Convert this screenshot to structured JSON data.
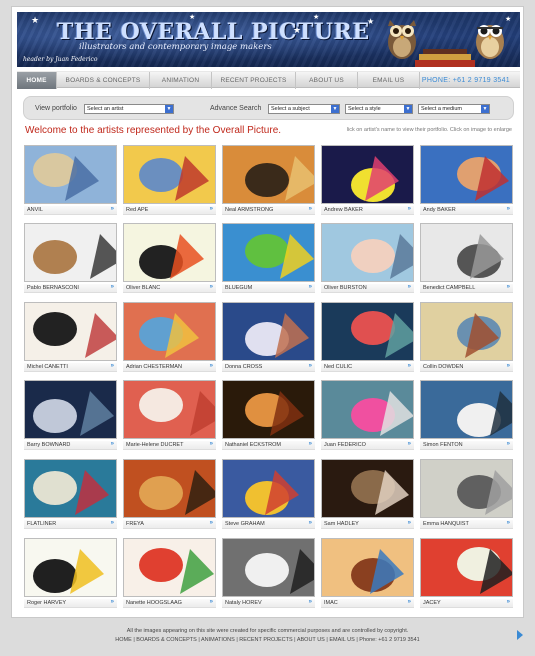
{
  "header": {
    "title": "THE OVERALL PICTURE",
    "subtitle": "illustrators and contemporary image makers",
    "credit": "header by Juan Federico"
  },
  "nav": {
    "items": [
      {
        "label": "HOME",
        "active": true
      },
      {
        "label": "BOARDS & CONCEPTS",
        "active": false
      },
      {
        "label": "ANIMATION",
        "active": false
      },
      {
        "label": "RECENT PROJECTS",
        "active": false
      },
      {
        "label": "ABOUT US",
        "active": false
      },
      {
        "label": "EMAIL US",
        "active": false
      }
    ],
    "phone": "PHONE: +61 2 9719 3541"
  },
  "search": {
    "view_label": "View portfolio",
    "artist_select": "Select an artist",
    "advance_label": "Advance Search",
    "subject_select": "Select a subject",
    "style_select": "Select a style",
    "medium_select": "Select a medium"
  },
  "welcome": "Welcome to the artists represented by the Overall Picture.",
  "hint": "lick on artist's name to view their portfolio. Click on image to enlarge",
  "artists": [
    {
      "name": "ANVIL"
    },
    {
      "name": "Red APE"
    },
    {
      "name": "Neal ARMSTRONG"
    },
    {
      "name": "Andrew BAKER"
    },
    {
      "name": "Andy BAKER"
    },
    {
      "name": "Pablo BERNASCONI"
    },
    {
      "name": "Oliver BLANC"
    },
    {
      "name": "BLUEGUM"
    },
    {
      "name": "Oliver BURSTON"
    },
    {
      "name": "Benedict CAMPBELL"
    },
    {
      "name": "Michel CANETTI"
    },
    {
      "name": "Adrian CHESTERMAN"
    },
    {
      "name": "Donna CROSS"
    },
    {
      "name": "Ned CULIC"
    },
    {
      "name": "Collin DOWDEN"
    },
    {
      "name": "Barry BOWNARD"
    },
    {
      "name": "Marie-Helene DUCRET"
    },
    {
      "name": "Nathaniel ECKSTROM"
    },
    {
      "name": "Juan FEDERICO"
    },
    {
      "name": "Simon FENTON"
    },
    {
      "name": "FLATLINER"
    },
    {
      "name": "FREYA"
    },
    {
      "name": "Steve GRAHAM"
    },
    {
      "name": "Sam HADLEY"
    },
    {
      "name": "Emma HANQUIST"
    },
    {
      "name": "Roger HARVEY"
    },
    {
      "name": "Nanette HOOGSLAAG"
    },
    {
      "name": "Nataly HOREV"
    },
    {
      "name": "IMAC"
    },
    {
      "name": "JACEY"
    }
  ],
  "thumb_palettes": [
    [
      "#8fb3d9",
      "#d9c8a0",
      "#4a6fa5"
    ],
    [
      "#f2c94c",
      "#6b8fbf",
      "#c0392b"
    ],
    [
      "#d98c3a",
      "#3a2a1a",
      "#e8c070"
    ],
    [
      "#1a1a4a",
      "#f0e030",
      "#e04070"
    ],
    [
      "#3a70c0",
      "#e0a070",
      "#c03030"
    ],
    [
      "#f0f0f0",
      "#b08050",
      "#3a3a3a"
    ],
    [
      "#f5f5e0",
      "#222222",
      "#e85020"
    ],
    [
      "#3a8fd0",
      "#60c040",
      "#f0d020"
    ],
    [
      "#a0c8e0",
      "#f0d0c0",
      "#5a7a9a"
    ],
    [
      "#e8e8e8",
      "#555555",
      "#999999"
    ],
    [
      "#f5f0e8",
      "#222222",
      "#c04040"
    ],
    [
      "#e07050",
      "#60a0d0",
      "#f0c040"
    ],
    [
      "#2a4a8a",
      "#e0e0f0",
      "#c07050"
    ],
    [
      "#1a3a5a",
      "#e05050",
      "#60a0a0"
    ],
    [
      "#e0d0a0",
      "#6a90b0",
      "#a05030"
    ],
    [
      "#1a2a4a",
      "#c0c8d8",
      "#6080a0"
    ],
    [
      "#e06050",
      "#f5e8e0",
      "#c04030"
    ],
    [
      "#2a1a0a",
      "#e09040",
      "#803010"
    ],
    [
      "#5a8a9a",
      "#f050a0",
      "#e0e0e0"
    ],
    [
      "#3a6a9a",
      "#f0f0f0",
      "#203040"
    ],
    [
      "#2a7a9a",
      "#e0e0d0",
      "#c03040"
    ],
    [
      "#c05020",
      "#e0a050",
      "#302010"
    ],
    [
      "#3a5aa0",
      "#f0c030",
      "#d04030"
    ],
    [
      "#2a1a10",
      "#8a6a4a",
      "#e0d0c0"
    ],
    [
      "#d0d0c8",
      "#606060",
      "#a0a0a0"
    ],
    [
      "#f8f8f0",
      "#202020",
      "#f0c020"
    ],
    [
      "#f8f0e8",
      "#e04030",
      "#40a040"
    ],
    [
      "#707070",
      "#f0f0f0",
      "#202020"
    ],
    [
      "#f0c080",
      "#8a4020",
      "#3a7ac0"
    ],
    [
      "#e04030",
      "#f0f0e0",
      "#202020"
    ]
  ],
  "footer": {
    "notice": "All the images appearing on this site were created for specific commercial purposes and are controlled by copyright.",
    "links": "HOME  |  BOARDS & CONCEPTS  |  ANIMATIONS  |  RECENT PROJECTS  |  ABOUT US  |  EMAIL US  |  Phone: +61 2 9719 3541"
  }
}
